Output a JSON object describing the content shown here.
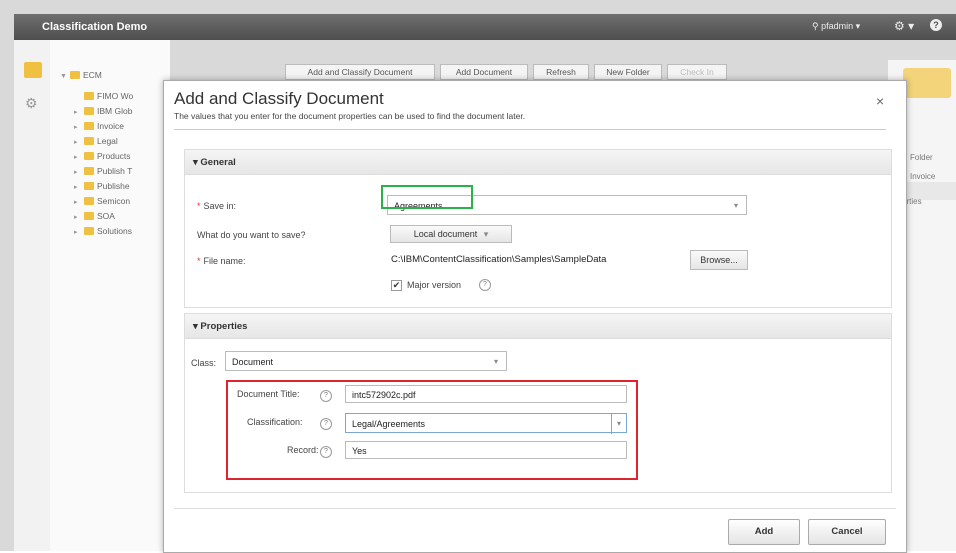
{
  "app": {
    "title": "Classification Demo",
    "user": "pfadmin",
    "user_chevron": "▾",
    "gear_chevron": "⚙ ▾",
    "help_symbol": "?"
  },
  "tree": {
    "root": "ECM",
    "items": [
      "FIMO Wo",
      "IBM Glob",
      "Invoice",
      "Legal",
      "Products",
      "Publish T",
      "Publishe",
      "Semicon",
      "SOA",
      "Solutions"
    ]
  },
  "toolbar": {
    "buttons": [
      "Add and Classify Document",
      "Add Document",
      "Refresh",
      "New Folder",
      "Check In"
    ]
  },
  "right_pane": {
    "items": [
      "Folder",
      "Invoice",
      "erties"
    ]
  },
  "dialog": {
    "title": "Add and Classify Document",
    "description": "The values that you enter for the document properties can be used to find the document later.",
    "close": "×",
    "general": {
      "header": "▾ General",
      "save_in_label": "Save in:",
      "save_in_value": "Agreements",
      "what_label": "What do you want to save?",
      "what_value": "Local document",
      "file_name_label": "File name:",
      "file_name_value": "C:\\IBM\\ContentClassification\\Samples\\SampleData",
      "browse_label": "Browse...",
      "major_version_label": "Major version",
      "required_marker": "*",
      "check_mark": "✔"
    },
    "properties": {
      "header": "▾ Properties",
      "class_label": "Class:",
      "class_value": "Document",
      "doc_title_label": "Document Title:",
      "doc_title_value": "intc572902c.pdf",
      "classification_label": "Classification:",
      "classification_value": "Legal/Agreements",
      "record_label": "Record:",
      "record_value": "Yes",
      "help_q": "?"
    },
    "add_label": "Add",
    "cancel_label": "Cancel"
  },
  "colors": {
    "highlight_green": "#2ab24a",
    "highlight_red": "#e0242c",
    "folder_yellow": "#f0c040"
  },
  "icons": {
    "dropdown": "▾"
  }
}
